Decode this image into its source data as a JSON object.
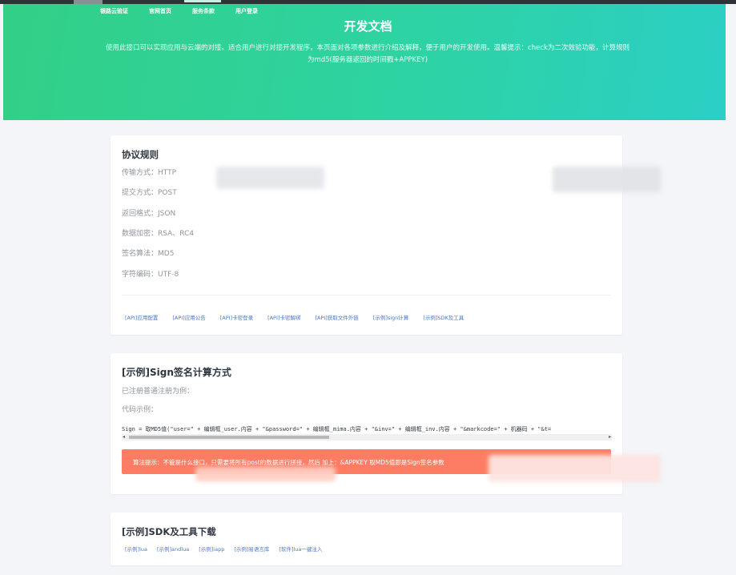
{
  "nav": {
    "items": [
      {
        "label": "银路云验证",
        "active": false
      },
      {
        "label": "官网首页",
        "active": false
      },
      {
        "label": "服务条款",
        "active": true
      },
      {
        "label": "用户登录",
        "active": false
      }
    ]
  },
  "hero": {
    "title": "开发文档",
    "description": "使用此接口可以实现应用与云端的对接。适合用户进行对接开发程序，本页面对各项参数进行介绍及解释，便于用户的开发使用。温馨提示：check为二次效验功能，计算规则为md5(服务器返回的时间戳+APPKEY)"
  },
  "protocol": {
    "title": "协议规则",
    "rules": [
      "传输方式：HTTP",
      "提交方式：POST",
      "返回格式：JSON",
      "数据加密：RSA、RC4",
      "签名算法：MD5",
      "字符编码：UTF-8"
    ],
    "links": [
      "[API]应用配置",
      "[API]应用公告",
      "[API]卡密登录",
      "[API]卡密解绑",
      "[API]获取文件外链",
      "[示例]sign计算",
      "[示例]SDK及工具"
    ]
  },
  "sign": {
    "title": "[示例]Sign签名计算方式",
    "subtitle": "已注册普通注册为例：",
    "code_label": "代码示例：",
    "code": "Sign = 取MD5值(\"user=\" + 编辑框_user.内容 + \"&password=\" + 编辑框_mima.内容 + \"&inv=\" + 编辑框_inv.内容 + \"&markcode=\" + 机器码 + \"&t=",
    "alert": "算法提示：不管是什么接口，只需要将所有post的数据进行拼接，然后 加上：&APPKEY 取MD5值即是Sign签名参数"
  },
  "sdk": {
    "title": "[示例]SDK及工具下载",
    "links": [
      "[示例]lua",
      "[示例]andlua",
      "[示例]iapp",
      "[示例]易语言库",
      "[软件]lua一键注入"
    ]
  },
  "colors": {
    "hero_start": "#32cf86",
    "hero_end": "#2ccfc5",
    "link": "#4a78c6",
    "alert": "#fc7d63",
    "background": "#f3f5f8"
  }
}
